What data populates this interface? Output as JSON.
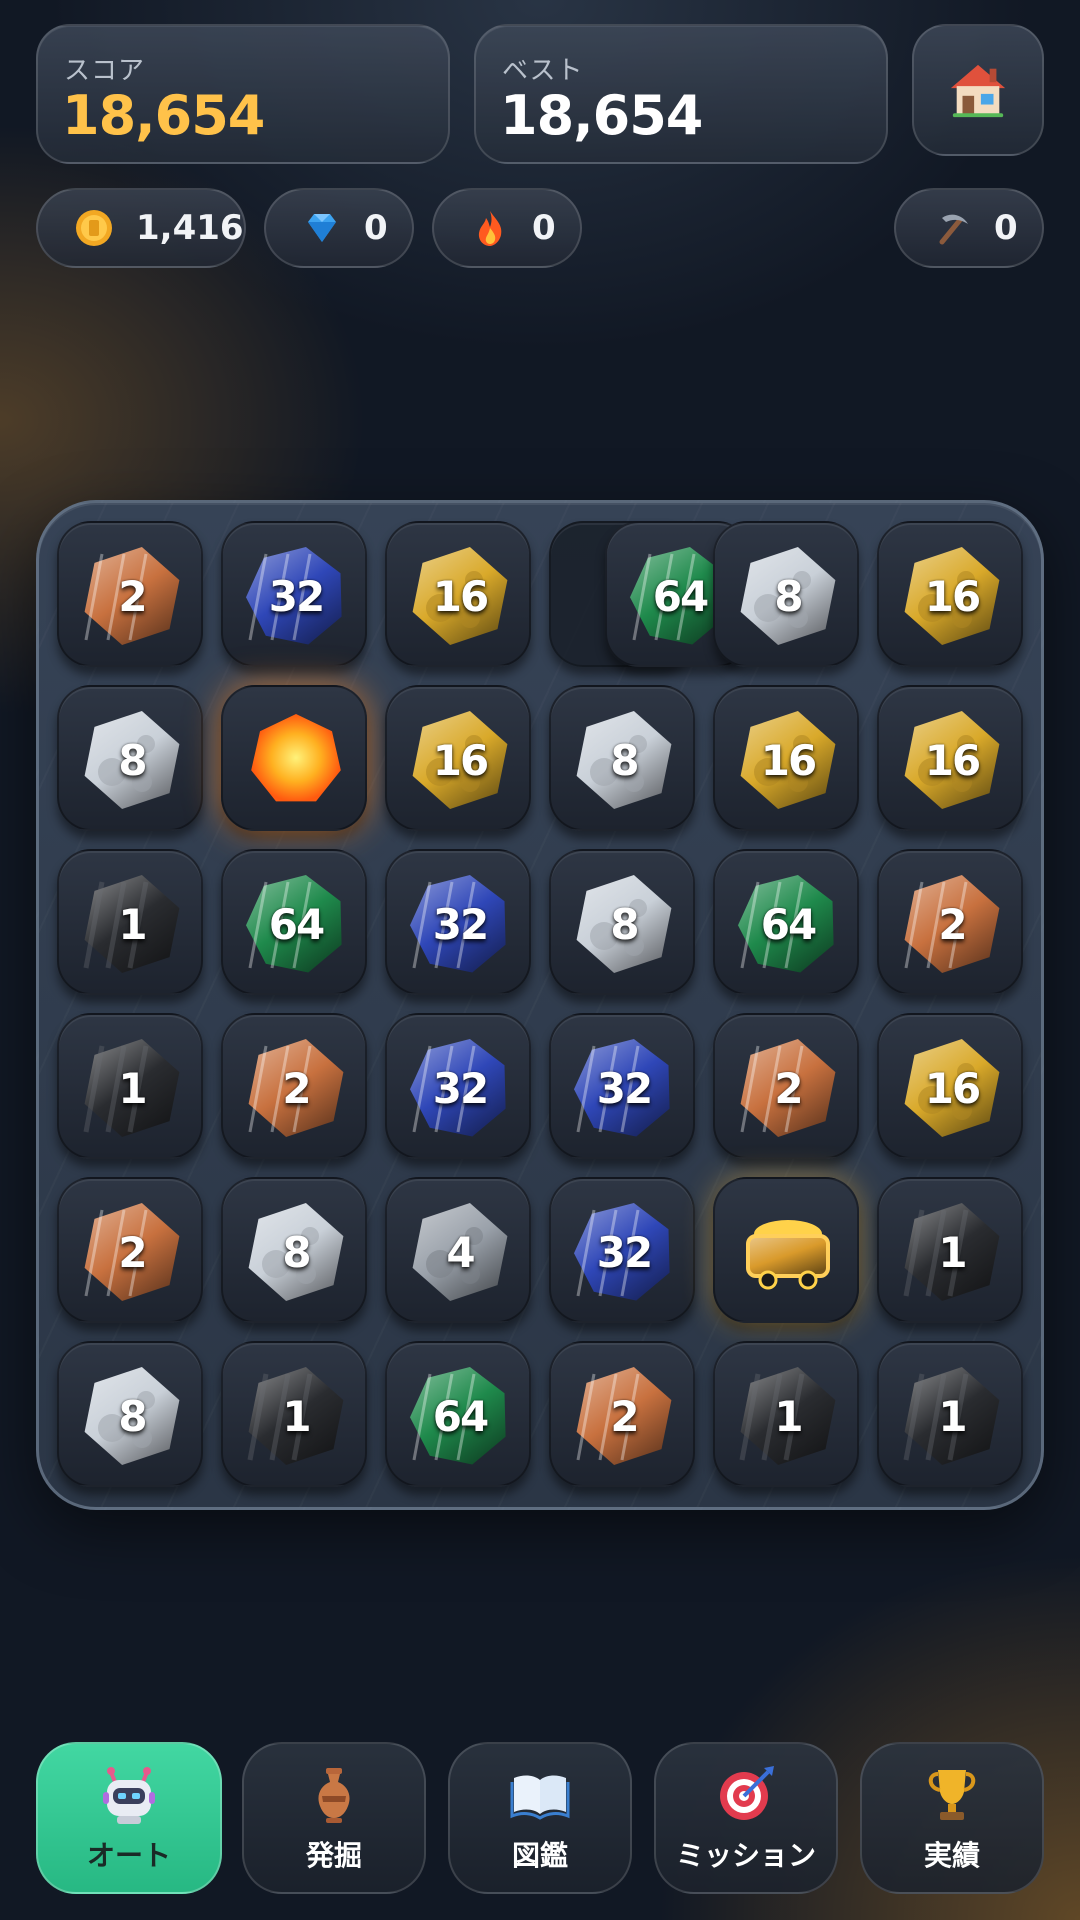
{
  "header": {
    "score_label": "スコア",
    "score_value": "18,654",
    "best_label": "ベスト",
    "best_value": "18,654",
    "home_icon": "house-icon"
  },
  "resources": {
    "coins": {
      "icon": "coin-icon",
      "value": "1,416"
    },
    "gems": {
      "icon": "diamond-icon",
      "value": "0"
    },
    "fire": {
      "icon": "flame-icon",
      "value": "0"
    },
    "pickaxe": {
      "icon": "pickaxe-icon",
      "value": "0"
    }
  },
  "board": {
    "rows": [
      [
        {
          "type": "copper",
          "value": "2"
        },
        {
          "type": "sapphire",
          "value": "32"
        },
        {
          "type": "gold",
          "value": "16"
        },
        {
          "type": "emerald",
          "value": "64",
          "note": "sliding"
        },
        {
          "type": "silver",
          "value": "8"
        },
        {
          "type": "gold",
          "value": "16"
        }
      ],
      [
        {
          "type": "silver",
          "value": "8"
        },
        {
          "type": "fire",
          "value": ""
        },
        {
          "type": "gold",
          "value": "16"
        },
        {
          "type": "silver",
          "value": "8"
        },
        {
          "type": "gold",
          "value": "16"
        },
        {
          "type": "gold",
          "value": "16"
        }
      ],
      [
        {
          "type": "coal",
          "value": "1"
        },
        {
          "type": "emerald",
          "value": "64"
        },
        {
          "type": "sapphire",
          "value": "32"
        },
        {
          "type": "silver",
          "value": "8"
        },
        {
          "type": "emerald",
          "value": "64"
        },
        {
          "type": "copper",
          "value": "2"
        }
      ],
      [
        {
          "type": "coal",
          "value": "1"
        },
        {
          "type": "copper",
          "value": "2"
        },
        {
          "type": "sapphire",
          "value": "32"
        },
        {
          "type": "sapphire",
          "value": "32"
        },
        {
          "type": "copper",
          "value": "2"
        },
        {
          "type": "gold",
          "value": "16"
        }
      ],
      [
        {
          "type": "copper",
          "value": "2"
        },
        {
          "type": "silver",
          "value": "8"
        },
        {
          "type": "iron",
          "value": "4"
        },
        {
          "type": "sapphire",
          "value": "32"
        },
        {
          "type": "cart",
          "value": ""
        },
        {
          "type": "coal",
          "value": "1"
        }
      ],
      [
        {
          "type": "silver",
          "value": "8"
        },
        {
          "type": "coal",
          "value": "1"
        },
        {
          "type": "emerald",
          "value": "64"
        },
        {
          "type": "copper",
          "value": "2"
        },
        {
          "type": "coal",
          "value": "1"
        },
        {
          "type": "coal",
          "value": "1"
        }
      ]
    ],
    "colors": {
      "copper": "#c8713f",
      "sapphire": "#2f47b8",
      "gold": "#d9a92a",
      "emerald": "#1f8a4c",
      "silver": "#c9d0d8",
      "coal": "#2a2c30",
      "iron": "#9aa1aa",
      "fire": "#ff9a1e",
      "cart": "#d99a2b"
    }
  },
  "nav": [
    {
      "label": "オート",
      "icon": "robot-icon",
      "active": true
    },
    {
      "label": "発掘",
      "icon": "vase-icon",
      "active": false
    },
    {
      "label": "図鑑",
      "icon": "book-icon",
      "active": false
    },
    {
      "label": "ミッション",
      "icon": "target-icon",
      "active": false
    },
    {
      "label": "実績",
      "icon": "trophy-icon",
      "active": false
    }
  ],
  "colors": {
    "score": "#ffc24a",
    "nav_active": "#3fcf9a",
    "background": "#111824"
  }
}
